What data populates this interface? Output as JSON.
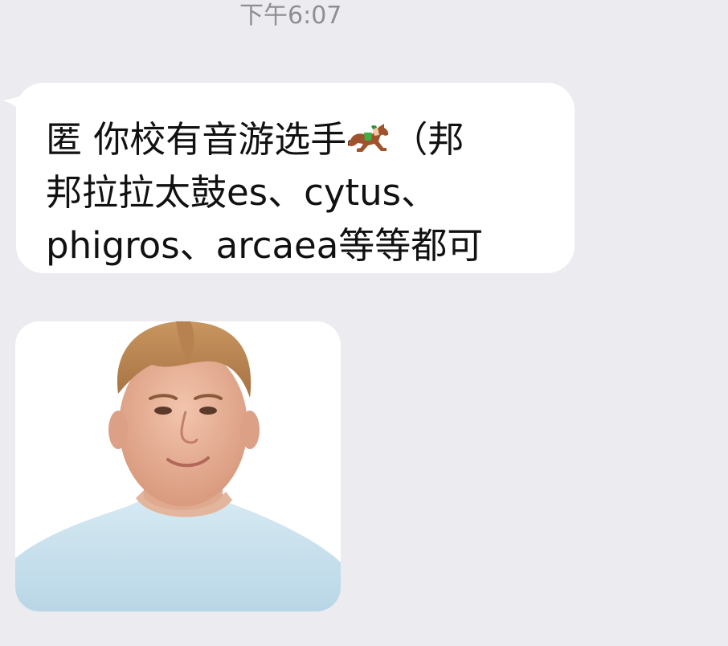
{
  "chat": {
    "timestamp": "下午6:07",
    "message": {
      "line1_before_icon": "匿 你校有音游选手",
      "icon": "racing-horse-icon",
      "line1_after_icon": "（邦",
      "line2": "邦拉拉太鼓es、cytus、",
      "line3": "phigros、arcaea等等都可"
    },
    "image_message": {
      "icon": "photo-portrait"
    }
  },
  "colors": {
    "background": "#ebebf0",
    "bubble": "#ffffff",
    "text": "#111111",
    "timestamp": "#8e8e93"
  }
}
